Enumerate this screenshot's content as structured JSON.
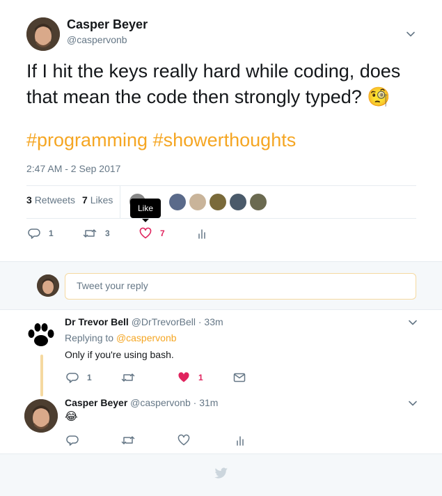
{
  "tweet": {
    "author_name": "Casper Beyer",
    "author_handle": "@caspervonb",
    "text": "If I hit the keys really hard while coding, does that mean the code then strongly typed?",
    "emoji": "🧐",
    "hashtags": "#programming #showerthoughts",
    "timestamp": "2:47 AM - 2 Sep 2017",
    "retweets_count": "3",
    "retweets_label": "Retweets",
    "likes_count": "7",
    "likes_label": "Likes",
    "tooltip": "Like",
    "actions": {
      "reply": "1",
      "retweet": "3",
      "like": "7"
    }
  },
  "reply_box": {
    "placeholder": "Tweet your reply"
  },
  "replies": [
    {
      "name": "Dr Trevor Bell",
      "handle": "@DrTrevorBell",
      "time": "· 33m",
      "replying_prefix": "Replying to",
      "replying_to": "@caspervonb",
      "text": "Only if you're using bash.",
      "reply_count": "1",
      "like_count": "1"
    },
    {
      "name": "Casper Beyer",
      "handle": "@caspervonb",
      "time": "· 31m",
      "text": "😂"
    }
  ],
  "colors": {
    "accent": "#f5a623",
    "like": "#e0245e",
    "muted": "#657786",
    "border": "#e6ecf0"
  }
}
